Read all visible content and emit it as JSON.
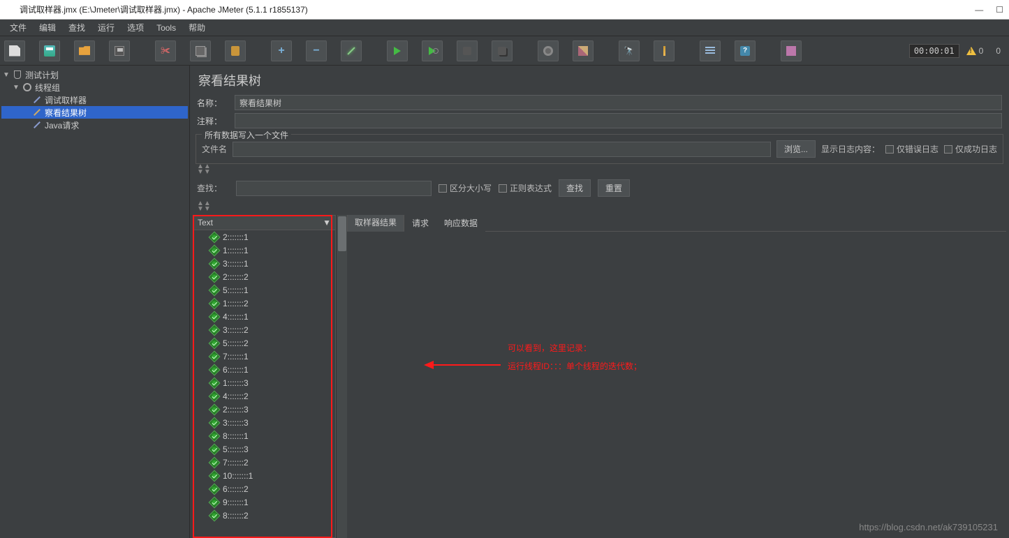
{
  "window": {
    "title": "调试取样器.jmx (E:\\Jmeter\\调试取样器.jmx) - Apache JMeter (5.1.1 r1855137)"
  },
  "menu": [
    "文件",
    "编辑",
    "查找",
    "运行",
    "选项",
    "Tools",
    "帮助"
  ],
  "toolbar": {
    "timer": "00:00:01",
    "warn_count": "0",
    "thread_count": "0"
  },
  "tree": {
    "root": "测试计划",
    "group": "线程组",
    "items": [
      "调试取样器",
      "察看结果树",
      "Java请求"
    ],
    "selected": "察看结果树"
  },
  "panel": {
    "title": "察看结果树",
    "name_label": "名称：",
    "name_value": "察看结果树",
    "comment_label": "注释：",
    "comment_value": "",
    "fieldset_legend": "所有数据写入一个文件",
    "file_label": "文件名",
    "file_value": "",
    "browse": "浏览...",
    "log_display_label": "显示日志内容：",
    "only_error": "仅错误日志",
    "only_success": "仅成功日志",
    "search_label": "查找：",
    "case_sensitive": "区分大小写",
    "regex": "正则表达式",
    "search_btn": "查找",
    "reset_btn": "重置",
    "renderer": "Text",
    "tabs": [
      "取样器结果",
      "请求",
      "响应数据"
    ]
  },
  "results": [
    "2:::::::1",
    "1:::::::1",
    "3:::::::1",
    "2:::::::2",
    "5:::::::1",
    "1:::::::2",
    "4:::::::1",
    "3:::::::2",
    "5:::::::2",
    "7:::::::1",
    "6:::::::1",
    "1:::::::3",
    "4:::::::2",
    "2:::::::3",
    "3:::::::3",
    "8:::::::1",
    "5:::::::3",
    "7:::::::2",
    "10:::::::1",
    "6:::::::2",
    "9:::::::1",
    "8:::::::2"
  ],
  "annotation": {
    "line1": "可以看到，这里记录：",
    "line2": "运行线程ID：：：单个线程的迭代数；"
  },
  "watermark": "https://blog.csdn.net/ak739105231"
}
